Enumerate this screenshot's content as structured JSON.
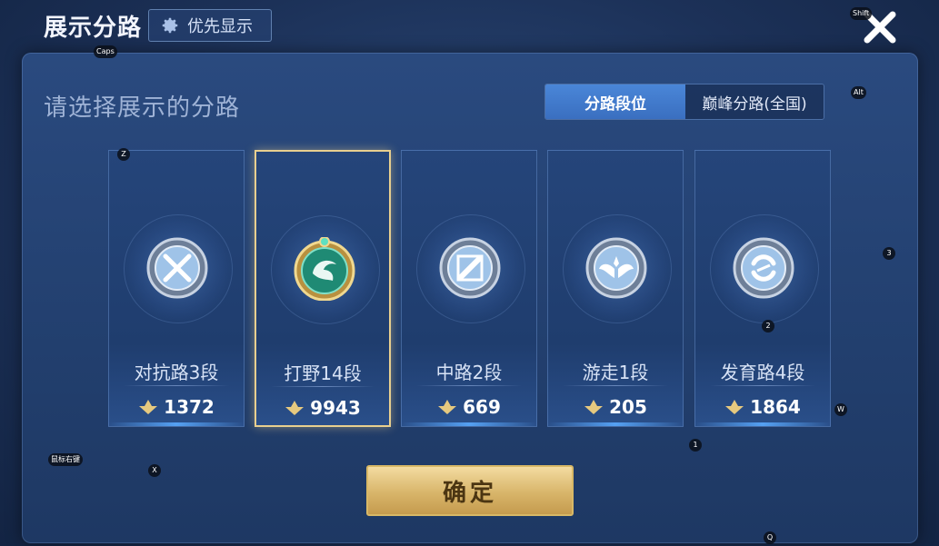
{
  "header": {
    "title": "展示分路",
    "priority_button": "优先显示"
  },
  "subtitle": "请选择展示的分路",
  "tabs": [
    {
      "label": "分路段位",
      "active": true
    },
    {
      "label": "巅峰分路(全国)",
      "active": false
    }
  ],
  "cards": [
    {
      "name": "对抗路3段",
      "score": "1372",
      "icon": "crossed-swords-icon",
      "selected": false
    },
    {
      "name": "打野14段",
      "score": "9943",
      "icon": "dragon-icon",
      "selected": true
    },
    {
      "name": "中路2段",
      "score": "669",
      "icon": "slash-staff-icon",
      "selected": false
    },
    {
      "name": "游走1段",
      "score": "205",
      "icon": "wings-icon",
      "selected": false
    },
    {
      "name": "发育路4段",
      "score": "1864",
      "icon": "cycle-icon",
      "selected": false
    }
  ],
  "confirm_label": "确定",
  "key_hints": [
    "Caps",
    "Shift",
    "Alt",
    "Z",
    "3",
    "2",
    "W",
    "1",
    "鼠标右键",
    "X",
    "Q"
  ],
  "colors": {
    "selected_border": "#e8cf8f",
    "confirm_gold": "#d8b56a",
    "active_tab": "#4a86d8"
  }
}
